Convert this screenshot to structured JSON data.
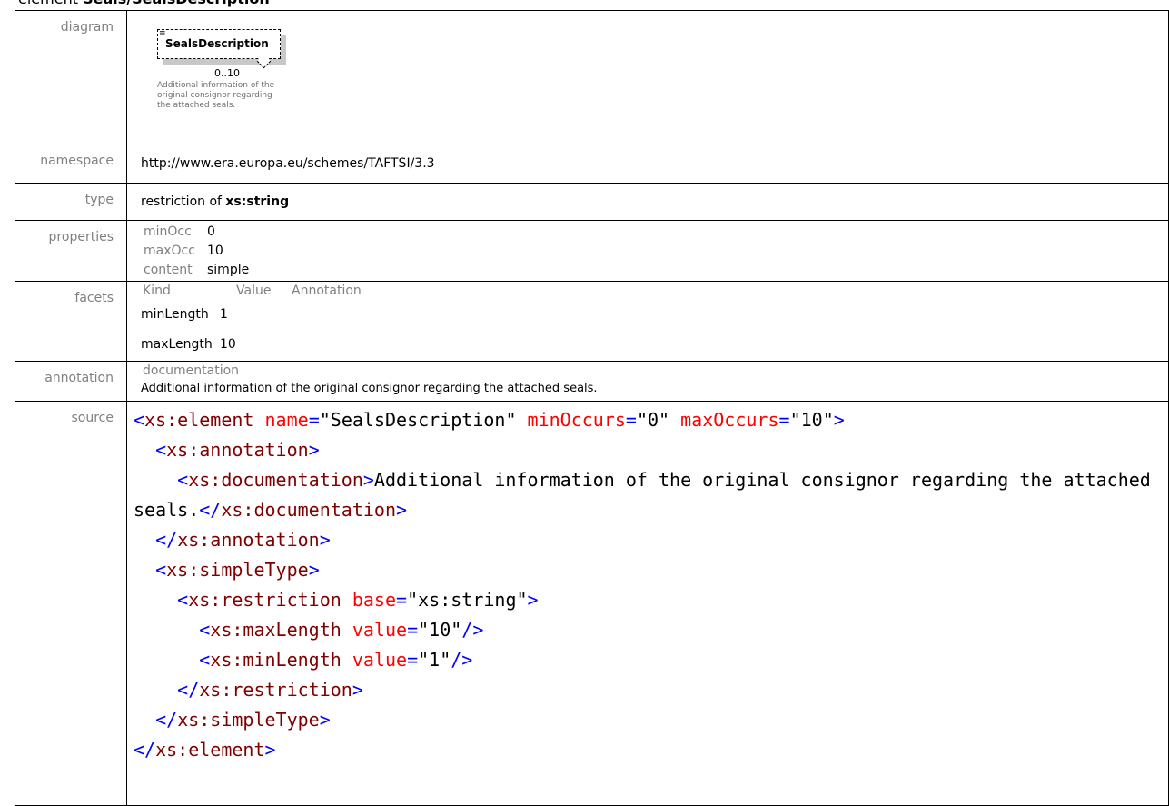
{
  "heading": {
    "prefix": "element ",
    "name": "Seals/SealsDescription"
  },
  "labels": {
    "diagram": "diagram",
    "namespace": "namespace",
    "type": "type",
    "properties": "properties",
    "facets": "facets",
    "annotation": "annotation",
    "source": "source"
  },
  "diagram": {
    "element_name": "SealsDescription",
    "occurrence": "0..10",
    "note": "Additional information of the original consignor regarding the attached seals."
  },
  "namespace": "http://www.era.europa.eu/schemes/TAFTSI/3.3",
  "type": {
    "prefix": "restriction of ",
    "base": "xs:string"
  },
  "properties": [
    {
      "key": "minOcc",
      "value": "0"
    },
    {
      "key": "maxOcc",
      "value": "10"
    },
    {
      "key": "content",
      "value": "simple"
    }
  ],
  "facets": {
    "headers": [
      "Kind",
      "Value",
      "Annotation"
    ],
    "rows": [
      {
        "kind": "minLength",
        "value": "1"
      },
      {
        "kind": "maxLength",
        "value": "10"
      }
    ]
  },
  "annotation": {
    "label": "documentation",
    "text": "Additional information of the original consignor regarding the attached seals."
  },
  "source": {
    "element_name_attr": "name",
    "element_name_val": "SealsDescription",
    "min_attr": "minOccurs",
    "min_val": "0",
    "max_attr": "maxOccurs",
    "max_val": "10",
    "doc_text": "Additional information of the original consignor regarding the attached seals.",
    "base_attr": "base",
    "base_val": "xs:string",
    "maxlength_attr": "value",
    "maxlength_val": "10",
    "minlength_attr": "value",
    "minlength_val": "1"
  },
  "colors": {
    "tag": "#0000ff",
    "name": "#800000",
    "attr": "#ff0000",
    "label": "#808080"
  }
}
